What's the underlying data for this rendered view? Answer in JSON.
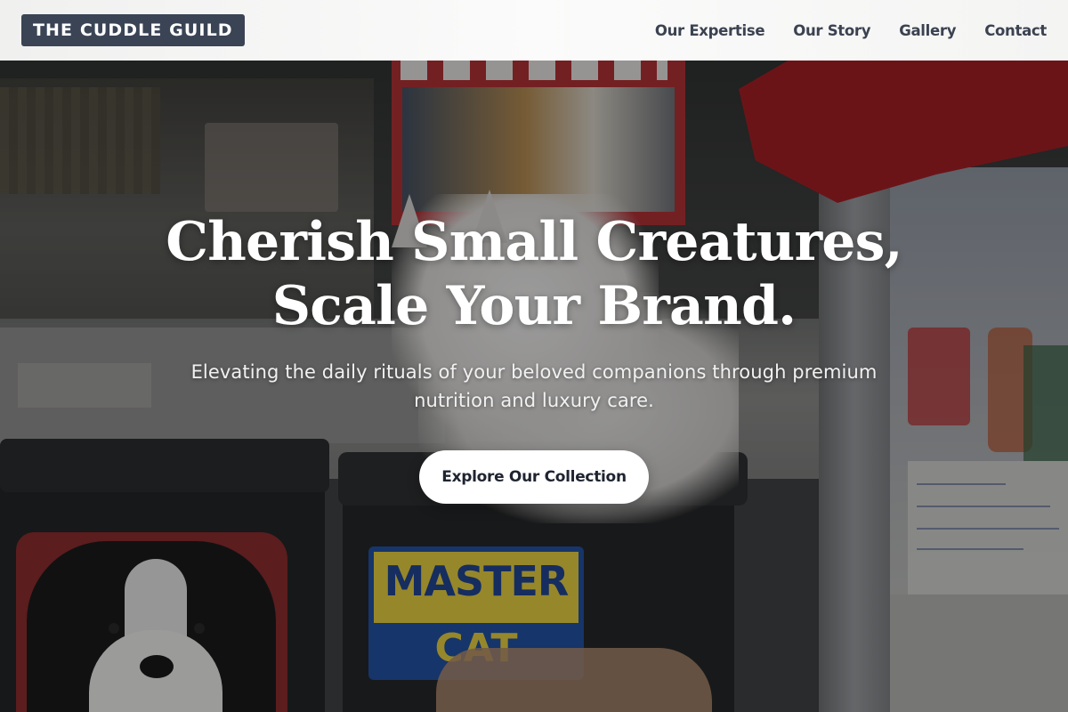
{
  "header": {
    "logo": "THE CUDDLE GUILD",
    "nav": [
      "Our Expertise",
      "Our Story",
      "Gallery",
      "Contact"
    ]
  },
  "hero": {
    "headline_line1": "Cherish Small Creatures,",
    "headline_line2": "Scale Your Brand.",
    "subtitle": "Elevating the daily rituals of your beloved companions through premium nutrition and luxury care.",
    "cta_label": "Explore Our Collection",
    "background_photo": {
      "sign_line1": "MASTER",
      "sign_line2": "CAT"
    }
  },
  "colors": {
    "logo_bg": "#3a4455",
    "nav_text": "#3b4250",
    "header_bg": "#f6f6f5",
    "cta_bg": "#ffffff",
    "cta_text": "#1f2430",
    "headline_text": "#ffffff"
  }
}
